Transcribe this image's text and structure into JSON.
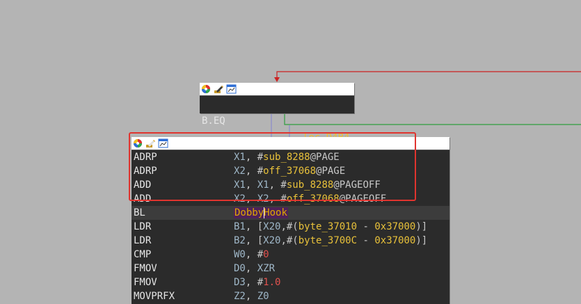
{
  "colors": {
    "background": "#b4b4b4",
    "node_bg": "#2b2b2b",
    "edge_true": "#cc2222",
    "edge_false": "#2e9e3e",
    "edge_flow": "#8a8acd",
    "selection": "#e0342f"
  },
  "icons": [
    "color-palette-icon",
    "edit-title-icon",
    "graph-overview-icon"
  ],
  "node_top": {
    "mnemonic": "B.EQ",
    "operand": "loc_D4B4"
  },
  "node_main": {
    "rows": [
      {
        "mn": "ADRP",
        "parts": [
          [
            "reg",
            "X1"
          ],
          [
            "plain",
            ", #"
          ],
          [
            "sym",
            "sub_8288"
          ],
          [
            "plain",
            "@PAGE"
          ]
        ]
      },
      {
        "mn": "ADRP",
        "parts": [
          [
            "reg",
            "X2"
          ],
          [
            "plain",
            ", #"
          ],
          [
            "sym",
            "off_37068"
          ],
          [
            "plain",
            "@PAGE"
          ]
        ]
      },
      {
        "mn": "ADD",
        "parts": [
          [
            "reg",
            "X1"
          ],
          [
            "plain",
            ", "
          ],
          [
            "reg",
            "X1"
          ],
          [
            "plain",
            ", #"
          ],
          [
            "sym",
            "sub_8288"
          ],
          [
            "plain",
            "@PAGEOFF"
          ]
        ]
      },
      {
        "mn": "ADD",
        "parts": [
          [
            "reg",
            "X2"
          ],
          [
            "plain",
            ", "
          ],
          [
            "reg",
            "X2"
          ],
          [
            "plain",
            ", #"
          ],
          [
            "sym",
            "off_37068"
          ],
          [
            "plain",
            "@PAGEOFF"
          ]
        ]
      },
      {
        "mn": "BL",
        "parts": [
          [
            "call",
            "DobbyHook"
          ]
        ],
        "highlight": true
      },
      {
        "mn": "LDR",
        "parts": [
          [
            "reg",
            "B1"
          ],
          [
            "plain",
            ", ["
          ],
          [
            "reg",
            "X20"
          ],
          [
            "plain",
            ",#("
          ],
          [
            "sym",
            "byte_37010"
          ],
          [
            "plain",
            " - "
          ],
          [
            "sym",
            "0x37000"
          ],
          [
            "plain",
            ")]"
          ]
        ]
      },
      {
        "mn": "LDR",
        "parts": [
          [
            "reg",
            "B2"
          ],
          [
            "plain",
            ", ["
          ],
          [
            "reg",
            "X20"
          ],
          [
            "plain",
            ",#("
          ],
          [
            "sym",
            "byte_3700C"
          ],
          [
            "plain",
            " - "
          ],
          [
            "sym",
            "0x37000"
          ],
          [
            "plain",
            ")]"
          ]
        ]
      },
      {
        "mn": "CMP",
        "parts": [
          [
            "reg",
            "W0"
          ],
          [
            "plain",
            ", #"
          ],
          [
            "num",
            "0"
          ]
        ]
      },
      {
        "mn": "FMOV",
        "parts": [
          [
            "reg",
            "D0"
          ],
          [
            "plain",
            ", "
          ],
          [
            "reg",
            "XZR"
          ]
        ]
      },
      {
        "mn": "FMOV",
        "parts": [
          [
            "reg",
            "D3"
          ],
          [
            "plain",
            ", #"
          ],
          [
            "num",
            "1.0"
          ]
        ]
      },
      {
        "mn": "MOVPRFX",
        "parts": [
          [
            "reg",
            "Z2"
          ],
          [
            "plain",
            ", "
          ],
          [
            "reg",
            "Z0"
          ]
        ]
      }
    ]
  }
}
